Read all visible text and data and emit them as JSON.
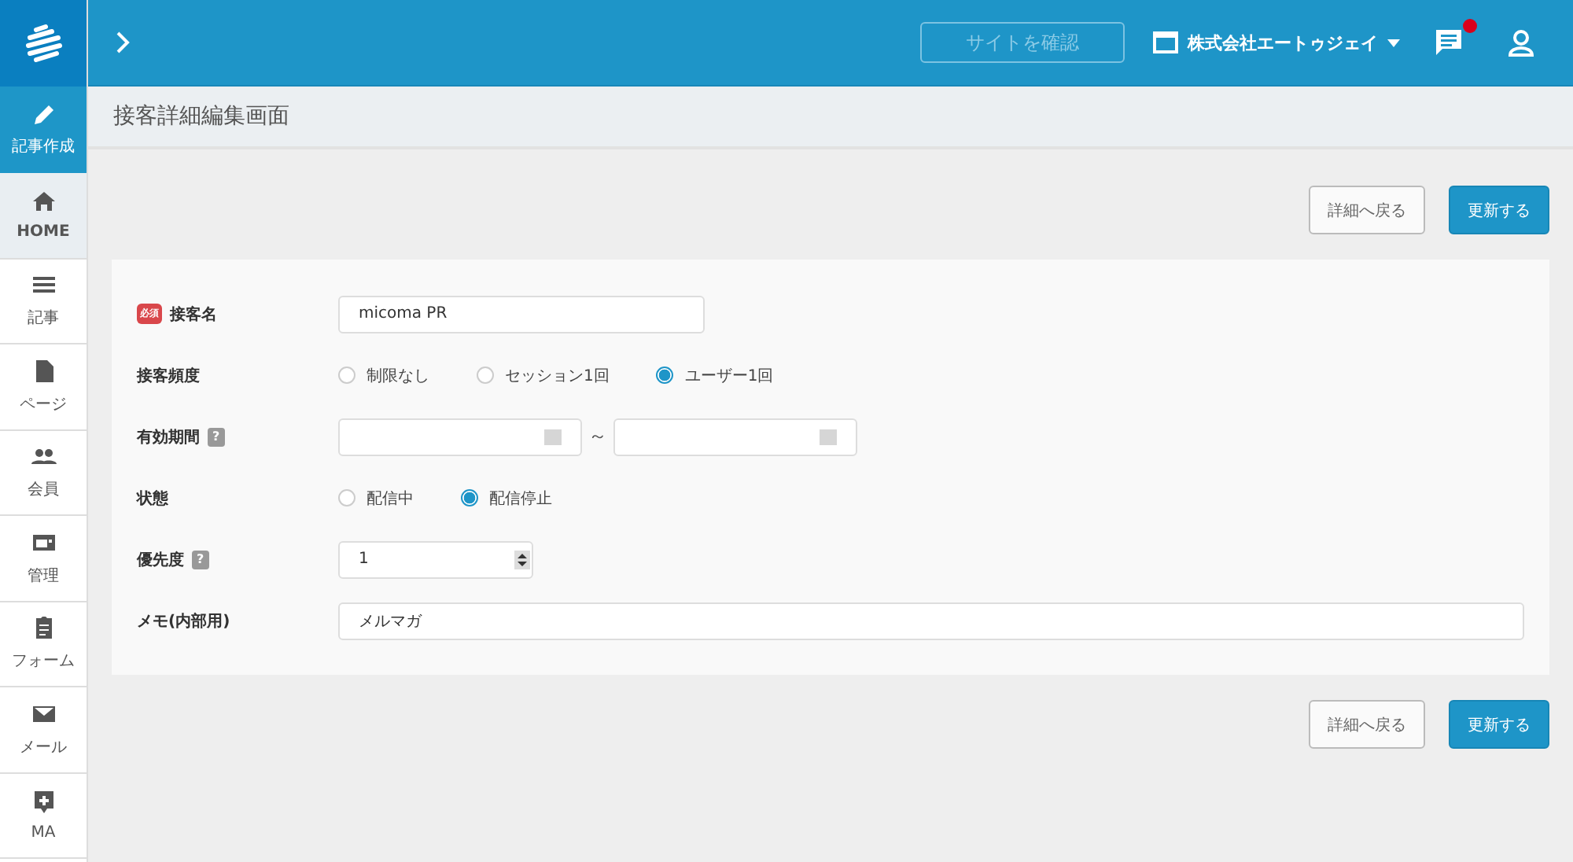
{
  "header": {
    "site_button": "サイトを確認",
    "company": "株式会社エートゥジェイ",
    "notification": true
  },
  "sidebar": {
    "create": "記事作成",
    "items": [
      {
        "label": "HOME",
        "selected": true
      },
      {
        "label": "記事",
        "selected": false
      },
      {
        "label": "ページ",
        "selected": false
      },
      {
        "label": "会員",
        "selected": false
      },
      {
        "label": "管理",
        "selected": false
      },
      {
        "label": "フォーム",
        "selected": false
      },
      {
        "label": "メール",
        "selected": false
      },
      {
        "label": "MA",
        "selected": false
      }
    ]
  },
  "page_title": "接客詳細編集画面",
  "actions": {
    "back": "詳細へ戻る",
    "update": "更新する"
  },
  "form": [
    {
      "kind": "text",
      "label": "接客名",
      "required_badge": "必須",
      "value": "micoma PR"
    },
    {
      "kind": "radio",
      "label": "接客頻度",
      "options": [
        {
          "label": "制限なし",
          "selected": false
        },
        {
          "label": "セッション1回",
          "selected": false
        },
        {
          "label": "ユーザー1回",
          "selected": true
        }
      ]
    },
    {
      "kind": "daterange",
      "label": "有効期間",
      "help": "?",
      "separator": "～"
    },
    {
      "kind": "radio",
      "label": "状態",
      "options": [
        {
          "label": "配信中",
          "selected": false
        },
        {
          "label": "配信停止",
          "selected": true
        }
      ]
    },
    {
      "kind": "number",
      "label": "優先度",
      "help": "?",
      "value": "1"
    },
    {
      "kind": "wide",
      "label": "メモ(内部用)",
      "value": "メルマガ"
    }
  ],
  "bottom_actions": {
    "back": "詳細へ戻る",
    "update": "更新する"
  }
}
